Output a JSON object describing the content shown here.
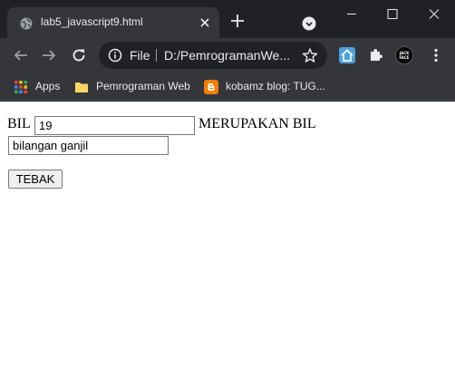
{
  "tab": {
    "title": "lab5_javascript9.html"
  },
  "toolbar": {
    "scheme_label": "File",
    "url": "D:/PemrogramanWe...",
    "avatar_text": "JACK\nFACE"
  },
  "bookmarks": [
    {
      "label": "Apps",
      "icon": "apps-grid-icon"
    },
    {
      "label": "Pemrograman Web",
      "icon": "folder-icon"
    },
    {
      "label": "kobamz blog: TUG...",
      "icon": "blogger-icon"
    }
  ],
  "form": {
    "bil_label": "BIL",
    "bil_value": "19",
    "result_label": "MERUPAKAN BIL",
    "result_value": "bilangan ganjil",
    "button_label": "TEBAK"
  },
  "colors": {
    "tabstrip_bg": "#202124",
    "toolbar_bg": "#35363a",
    "text_light": "#e8eaed",
    "page_bg": "#ffffff"
  }
}
